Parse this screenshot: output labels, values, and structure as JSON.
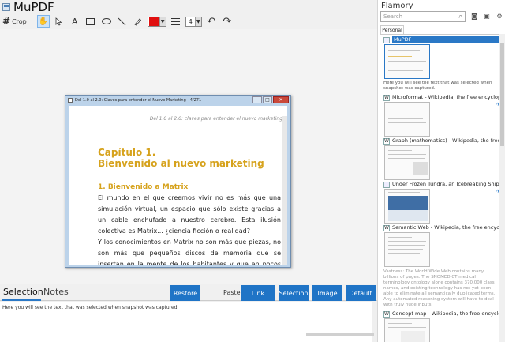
{
  "app": {
    "title": "MuPDF"
  },
  "toolbar": {
    "crop_label": "Crop",
    "text_tool": "A",
    "stroke_width": "4",
    "color": "#e01010"
  },
  "snapshot_window": {
    "title": "Del 1.0 al 2.0: Claves para entender el Nuevo Marketing - 4/271",
    "header": "Del 1.0 al 2.0: claves para entender el nuevo marketing",
    "chapter": "Capítulo 1.",
    "chapter_title": "Bienvenido al nuevo marketing",
    "section": "1. Bienvenido a Matrix",
    "paragraph1": "El mundo en el que creemos vivir no es más que una simulación virtual, un espacio que sólo existe gracias a un cable enchufado a nuestro cerebro. Esta ilusión colectiva es Matrix... ¿ciencia ficción o realidad?",
    "paragraph2": "Y los conocimientos en Matrix no son más que piezas, no son más que pequeños discos de memoria que se insertan en la mente de los habitantes y que en pocos segundos les confieren todo lo necesario para desarrollar una actividad en este entorno.",
    "accent_color": "#d6a21c"
  },
  "bottom": {
    "tab_selection": "Selection",
    "tab_notes": "Notes",
    "restore_label": "Restore",
    "paste_label": "Paste:",
    "link_label": "Link",
    "selection_label": "Selection",
    "image_label": "Image",
    "default_label": "Default",
    "notes_text": "Here you will see the text that was selected when snapshot was captured.",
    "button_color": "#1f74c6"
  },
  "flamory": {
    "title": "Flamory",
    "search_placeholder": "Search",
    "personal_tab": "Personal",
    "entries": [
      {
        "title": "MuPDF",
        "desc": "Here you will see the text that was selected when snapshot was captured."
      },
      {
        "title": "Microformat - Wikipedia, the free encyclopedia",
        "desc": ""
      },
      {
        "title": "Graph (mathematics) - Wikipedia, the free encyclopedia",
        "desc": ""
      },
      {
        "title": "Under Frozen Tundra, an Icebreaking Ship Uncovers...",
        "desc": ""
      },
      {
        "title": "Semantic Web - Wikipedia, the free encyclopedia",
        "desc": "Vastness: The World Wide Web contains many billions of pages. The SNOMED CT medical terminology ontology alone contains 370,000 class names, and existing technology has not yet been able to eliminate all semantically duplicated terms. Any automated reasoning system will have to deal with truly huge inputs."
      },
      {
        "title": "Concept map - Wikipedia, the free encyclopedia",
        "desc": ""
      }
    ]
  }
}
